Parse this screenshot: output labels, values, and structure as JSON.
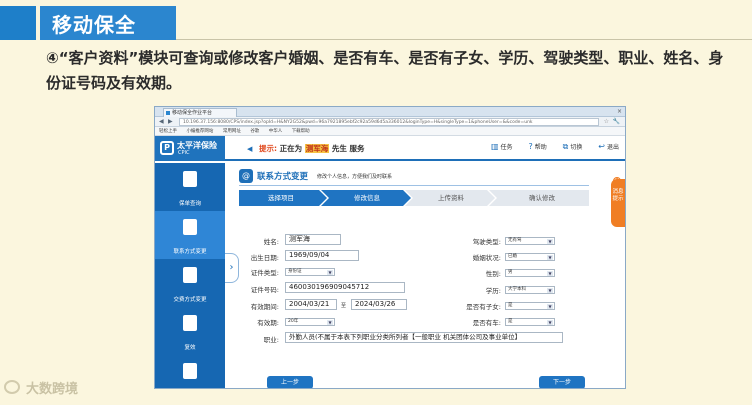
{
  "slide": {
    "title": "移动保全",
    "description": "④“客户资料”模块可查询或修改客户婚姻、是否有车、是否有子女、学历、驾驶类型、职业、姓名、身份证号码及有效期。",
    "watermark": "大数跨境"
  },
  "browser": {
    "tab_title": "移动保全作业平台",
    "tab_close": "×",
    "back": "◀",
    "forward": "▶",
    "url": "10.196.37.156:8080/CPS/index.jsp?opId=H&NY2G52&pwd=96a7921895ebf2c92a59d6d5a336012&loginType=H&singleType=1&phoneUser=&&code=unk",
    "star": "☆",
    "wrench": "🔧",
    "bookmarks": [
      "轻松上手",
      "小编推荐网站",
      "常用网址",
      "谷歌",
      "中华人",
      "下载帮助"
    ]
  },
  "app": {
    "brand": "太平洋保险",
    "brand_sub": "CPIC",
    "logo_mark": "P",
    "tip_prefix": "提示:",
    "tip_mid": "正在为",
    "customer": "测军海",
    "tip_suffix": "先生 服务",
    "tools": [
      {
        "icon": "▥",
        "label": "任务"
      },
      {
        "icon": "?",
        "label": "帮助"
      },
      {
        "icon": "⧉",
        "label": "切换"
      },
      {
        "icon": "↩",
        "label": "退出"
      }
    ]
  },
  "sidebar": {
    "items": [
      {
        "label": "保单查询"
      },
      {
        "label": "联系方式变更"
      },
      {
        "label": "交费方式变更"
      },
      {
        "label": "复效"
      },
      {
        "label": "退保"
      }
    ],
    "toggle": "›"
  },
  "section": {
    "icon": "@",
    "title": "联系方式变更",
    "subtitle": "修改个人信息，方便我们及时联系"
  },
  "steps": [
    "选择项目",
    "修改信息",
    "上传资料",
    "确认修改"
  ],
  "form": {
    "name_label": "姓名:",
    "name": "测军海",
    "birth_label": "出生日期:",
    "birth": "1969/09/04",
    "idtype_label": "证件类型:",
    "idtype": "身份证",
    "idno_label": "证件号码:",
    "idno": "460030196909045712",
    "valid_label": "有效期间:",
    "valid_from": "2004/03/21",
    "to": "至",
    "valid_to": "2024/03/26",
    "validity_label": "有效期:",
    "validity": "20年",
    "job_label": "职业:",
    "job": "外勤人员(不属于本表下列职业分类所列者【一般职业 机关团体公司及事业单位】",
    "drive_label": "驾驶类型:",
    "drive": "无有驾",
    "marital_label": "婚姻状况:",
    "marital": "已婚",
    "gender_label": "性别:",
    "gender": "男",
    "edu_label": "学历:",
    "edu": "大学本科",
    "child_label": "是否有子女:",
    "child": "是",
    "car_label": "是否有车:",
    "car": "是"
  },
  "buttons": {
    "prev": "上一步",
    "next": "下一步"
  },
  "msg_tab": {
    "badge": "3",
    "label": "消息提示"
  },
  "colors": {
    "brand": "#1f73bd",
    "accent": "#f07e24",
    "slide_bg": "#fbf6de"
  }
}
